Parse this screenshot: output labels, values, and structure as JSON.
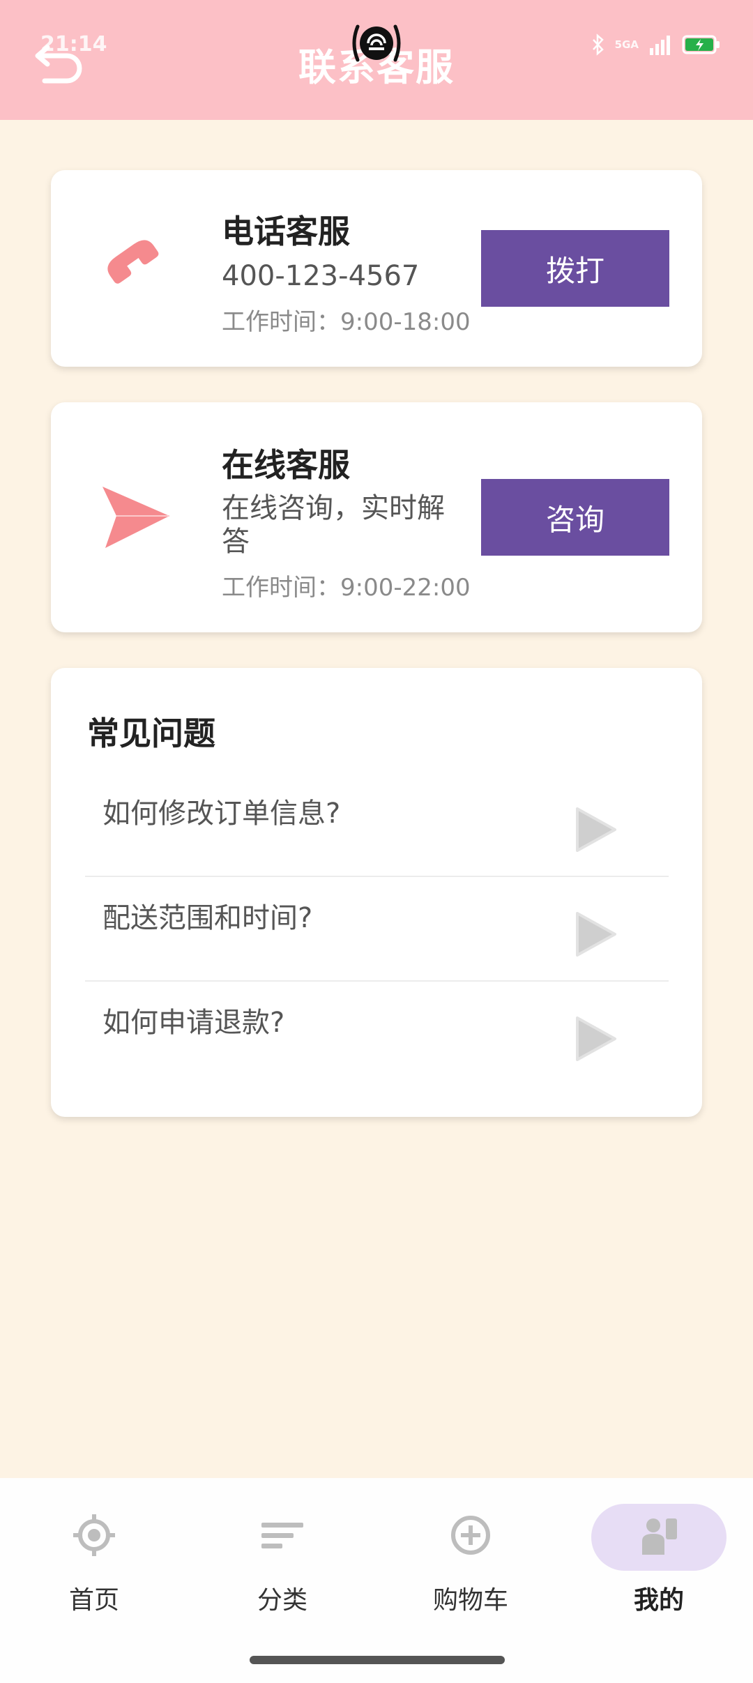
{
  "status_bar": {
    "time": "21:14",
    "network": "5GA"
  },
  "header": {
    "title": "联系客服"
  },
  "services": {
    "phone": {
      "name": "电话客服",
      "number": "400-123-4567",
      "hours": "工作时间：9:00-18:00",
      "button_label": "拨打",
      "icon": "phone-icon",
      "icon_color": "#f58a8e"
    },
    "online": {
      "name": "在线客服",
      "desc_line1": "在线咨询，实时解",
      "desc_line2": "答",
      "hours": "工作时间：9:00-22:00",
      "button_label": "咨询",
      "icon": "paper-plane-icon",
      "icon_color": "#f58a8e"
    }
  },
  "faq": {
    "title": "常见问题",
    "items": [
      {
        "question": "如何修改订单信息?"
      },
      {
        "question": "配送范围和时间?"
      },
      {
        "question": "如何申请退款?"
      }
    ]
  },
  "bottom_nav": {
    "items": [
      {
        "label": "首页",
        "icon": "compass-icon"
      },
      {
        "label": "分类",
        "icon": "list-icon"
      },
      {
        "label": "购物车",
        "icon": "add-circle-icon"
      },
      {
        "label": "我的",
        "icon": "user-icon"
      }
    ],
    "active_index": 3
  },
  "colors": {
    "header_bg": "#fcc0c6",
    "page_bg": "#fdf3e4",
    "button_bg": "#6a4ea0",
    "active_tab_bg": "#e7ddf5"
  }
}
